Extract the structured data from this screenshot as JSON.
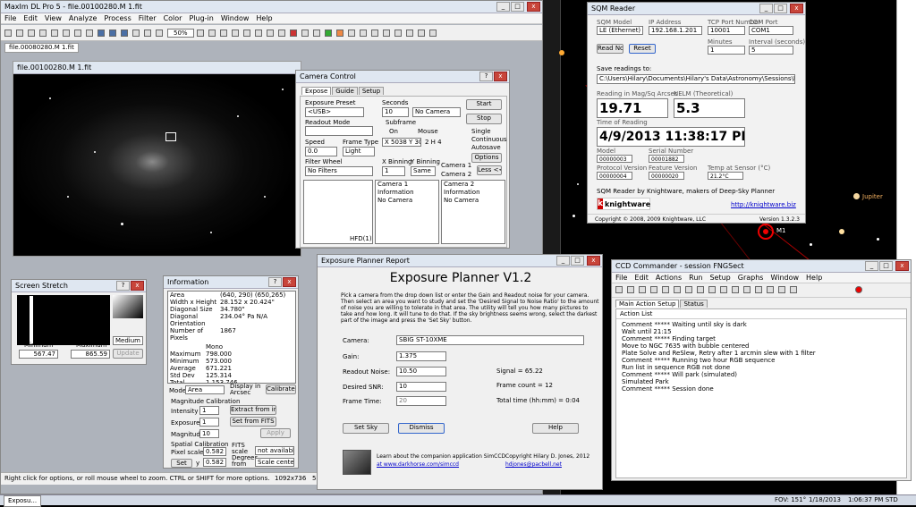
{
  "maxim": {
    "title": "MaxIm DL Pro 5 - file.00100280.M 1.fit",
    "menu": [
      "File",
      "Edit",
      "View",
      "Analyze",
      "Process",
      "Filter",
      "Color",
      "Plug-in",
      "Window",
      "Help"
    ],
    "zoom": "50%",
    "doc_tab": "file.00080280.M 1.fit",
    "image_title": "file.00100280.M 1.fit",
    "status_left": "Right click for options, or roll mouse wheel to zoom. CTRL or SHIFT for more options.",
    "status_size": "1092x736",
    "status_extra": "50"
  },
  "camera": {
    "title": "Camera Control",
    "tabs": [
      "Expose",
      "Guide",
      "Setup"
    ],
    "expose_preset_label": "Exposure Preset",
    "expose_preset": "<USB>",
    "seconds_label": "Seconds",
    "seconds": "10",
    "no_camera": "No Camera",
    "readout_label": "Readout Mode",
    "subframe_label": "Subframe",
    "on": "On",
    "mouse": "Mouse",
    "coords": "X 5038 Y 3069",
    "coords2": "2 H 4",
    "speed_label": "Speed",
    "speed": "0.0",
    "frame_label": "Frame Type",
    "frame": "Light",
    "filter_label": "Filter Wheel",
    "filter": "No Filters",
    "xbin_label": "X Binning",
    "xbin": "1",
    "ybin_label": "Y Binning",
    "ybin": "Same",
    "start": "Start",
    "stop": "Stop",
    "single": "Single",
    "continuous": "Continuous",
    "autosave": "Autosave",
    "options": "Options",
    "less": "Less <<",
    "camera1": "Camera 1",
    "camera2": "Camera 2",
    "cam1_info": "Camera 1 Information",
    "cam1_status": "No Camera",
    "cam2_info": "Camera 2 Information",
    "cam2_status": "No Camera",
    "hfd": "HFD(1)"
  },
  "stretch": {
    "title": "Screen Stretch",
    "min_label": "Minimum",
    "max_label": "Maximum",
    "min": "567.47",
    "max": "865.59",
    "mode": "Medium",
    "update": "Update"
  },
  "info": {
    "title": "Information",
    "rows": [
      [
        "Area",
        "(640, 290) (650,265)"
      ],
      [
        "Width x Height",
        "28.152 x 20.424\""
      ],
      [
        "Diagonal Size",
        "34.780\""
      ],
      [
        "Diagonal Orientation",
        "234.04°  Pa  N/A"
      ],
      [
        "Number of Pixels",
        "1867"
      ]
    ],
    "mono_label": "Mono",
    "stats": [
      [
        "Maximum",
        "798.000"
      ],
      [
        "Minimum",
        "573.000"
      ],
      [
        "Average",
        "671.221"
      ],
      [
        "Std Dev",
        "125.314"
      ],
      [
        "Total",
        "1,153,746"
      ]
    ],
    "mode_label": "Mode",
    "mode": "Area",
    "display_label": "Display in Arcsec",
    "calibrate": "Calibrate <<",
    "mag_cal": "Magnitude Calibration",
    "intensity": "Intensity",
    "intensity_val": "1",
    "extract_btn": "Extract from image",
    "exposure": "Exposure",
    "exposure_val": "1",
    "set_fits": "Set from FITS",
    "magnitude": "Magnitude",
    "mag_val": "10",
    "apply": "Apply",
    "scale_cal": "Spatial Calibration",
    "pixel_scale": "Pixel scale",
    "x_val": "0.582",
    "fits_label": "FITS scale",
    "not_avail": "not available",
    "set": "Set",
    "y_label": "y",
    "y_val": "0.582",
    "degrees": "Degrees from",
    "scale_mode": "Scale center"
  },
  "sqm": {
    "title": "SQM Reader",
    "model_label": "SQM Model",
    "model": "LE (Ethernet)",
    "ip_label": "IP Address",
    "ip": "192.168.1.201",
    "port_label": "TCP Port Number",
    "port": "10001",
    "com_label": "COM Port",
    "com": "COM1",
    "read_now": "Read Now",
    "reset": "Reset",
    "minutes_label": "Minutes",
    "minutes": "1",
    "interval_label": "Interval (seconds)",
    "interval": "5",
    "save_label": "Save readings to:",
    "save_path": "C:\\Users\\Hilary\\Documents\\Hilary's Data\\Astronomy\\Sessions\\Raw Da",
    "reading_label": "Reading in Mag/Sq Arcsec",
    "reading": "19.71",
    "nelm_label": "NELM (Theoretical)",
    "nelm": "5.3",
    "time_label": "Time of Reading",
    "time": "4/9/2013  11:38:17 PM",
    "model2_label": "Model",
    "model2": "00000003",
    "serial_label": "Serial Number",
    "serial": "00001882",
    "proto_label": "Protocol Version",
    "proto": "00000004",
    "feature_label": "Feature Version",
    "feature": "00000020",
    "temp_label": "Temp at Sensor (°C)",
    "temp": "21.2°C",
    "brand_text": "SQM Reader by Knightware, makers of Deep-Sky Planner",
    "brand": "knightware",
    "url": "http://knightware.biz",
    "copyright": "Copyright © 2008, 2009 Knightware, LLC",
    "version": "Version 1.3.2.3"
  },
  "planner": {
    "title": "Exposure Planner Report",
    "heading": "Exposure Planner V1.2",
    "desc": "Pick a camera from the drop down list or enter the Gain and Readout noise for your camera.  Then select an area you want to study and set the 'Desired Signal to Noise Ratio' to the amount of noise you are willing to tolerate in that area.  The utility will tell you how many pictures to take and how long. It will tune to do that. If the sky brightness seems wrong, select the darkest part of the image and press the 'Set Sky' button.",
    "camera_label": "Camera:",
    "camera": "SBIG ST-10XME",
    "gain_label": "Gain:",
    "gain": "1.375",
    "readout_label": "Readout Noise:",
    "readout": "10.50",
    "snr_label": "Desired SNR:",
    "snr": "10",
    "frame_label": "Frame Time:",
    "frame": "20",
    "signal": "Signal = 65.22",
    "frame_count": "Frame count = 12",
    "total": "Total time (hh:mm) = 0:04",
    "set_sky": "Set Sky",
    "dismiss": "Dismiss",
    "help": "Help",
    "learn": "Learn about the companion application SimCCD",
    "learn_url": "at www.darkhorse.com/simccd",
    "copyright": "Copyright Hilary D. Jones, 2012",
    "email": "hdjones@pacbell.net"
  },
  "ccd": {
    "title": "CCD Commander - session  FNGSect",
    "menu": [
      "File",
      "Edit",
      "Actions",
      "Run",
      "Setup",
      "Graphs",
      "Window",
      "Help"
    ],
    "tabs": [
      "Main Action Setup",
      "Status"
    ],
    "list_title": "Action List",
    "actions": [
      "Comment  ***** Waiting until sky is dark",
      "Wait until 21:15",
      "Comment  ***** Finding target",
      "Move to NGC 7635 with bubble centered",
      "Plate Solve and ReSlew, Retry after 1 arcmin slew with 1 filter",
      "Comment  ***** Running two hour RGB sequence",
      "Run list in sequence RGB not done",
      "Comment  ***** Will park (simulated)",
      "Simulated Park",
      "Comment  ***** Session done"
    ]
  },
  "sky": {
    "jupiter": "Jupiter",
    "marker": "M1"
  },
  "taskbar": {
    "start": "Exposu...",
    "fov": "FOV: 151°",
    "date": "1/18/2013",
    "time": "1:06:37 PM STD"
  }
}
